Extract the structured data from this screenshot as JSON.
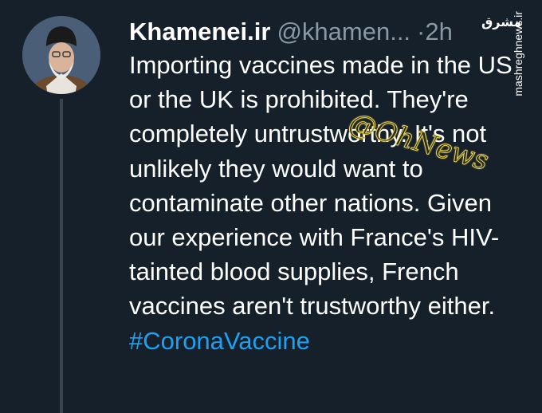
{
  "tweet": {
    "display_name": "Khamenei.ir",
    "handle": "@khamen...",
    "separator": "·",
    "time": "2h",
    "text": "Importing vaccines made in the US or the UK is prohibited. They're completely untrustworthy. It's not unlikely they would want to contaminate other nations. Given our experience with France's HIV-tainted blood supplies, French vaccines aren't trustworthy either.",
    "hashtag": "#CoronaVaccine"
  },
  "watermark": {
    "text": "@OhNews"
  },
  "site_logo": {
    "mark": "مشرق",
    "text": "mashreghnews.ir"
  },
  "colors": {
    "background": "#15202b",
    "text": "#ffffff",
    "secondary": "#8899a6",
    "link": "#1da1f2",
    "thread_line": "#38444d"
  }
}
